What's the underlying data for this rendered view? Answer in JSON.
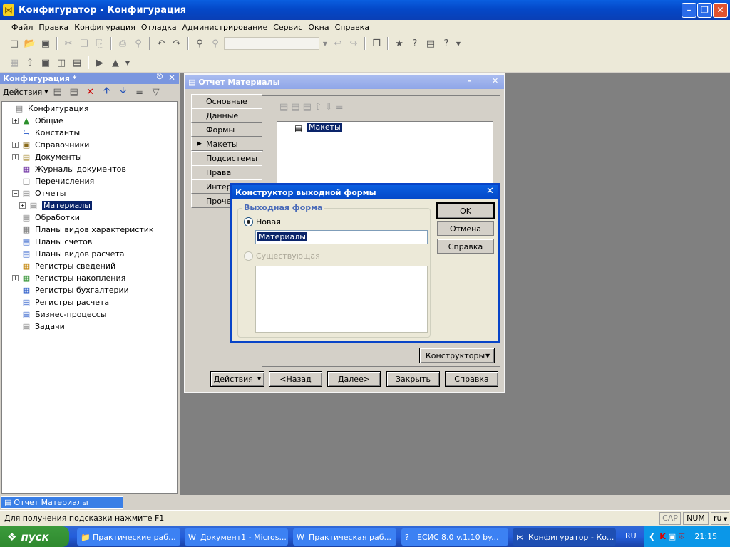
{
  "window": {
    "title": "Конфигуратор - Конфигурация"
  },
  "menu": [
    "Файл",
    "Правка",
    "Конфигурация",
    "Отладка",
    "Администрирование",
    "Сервис",
    "Окна",
    "Справка"
  ],
  "left_panel": {
    "title": "Конфигурация *",
    "actions_label": "Действия",
    "tree": [
      {
        "label": "Конфигурация",
        "level": 0,
        "expander": ""
      },
      {
        "label": "Общие",
        "level": 1,
        "expander": "+"
      },
      {
        "label": "Константы",
        "level": 1,
        "expander": ""
      },
      {
        "label": "Справочники",
        "level": 1,
        "expander": "+"
      },
      {
        "label": "Документы",
        "level": 1,
        "expander": "+"
      },
      {
        "label": "Журналы документов",
        "level": 1,
        "expander": ""
      },
      {
        "label": "Перечисления",
        "level": 1,
        "expander": ""
      },
      {
        "label": "Отчеты",
        "level": 1,
        "expander": "−"
      },
      {
        "label": "Материалы",
        "level": 2,
        "expander": "+",
        "selected": true
      },
      {
        "label": "Обработки",
        "level": 1,
        "expander": ""
      },
      {
        "label": "Планы видов характеристик",
        "level": 1,
        "expander": ""
      },
      {
        "label": "Планы счетов",
        "level": 1,
        "expander": ""
      },
      {
        "label": "Планы видов расчета",
        "level": 1,
        "expander": ""
      },
      {
        "label": "Регистры сведений",
        "level": 1,
        "expander": ""
      },
      {
        "label": "Регистры накопления",
        "level": 1,
        "expander": "+"
      },
      {
        "label": "Регистры бухгалтерии",
        "level": 1,
        "expander": ""
      },
      {
        "label": "Регистры расчета",
        "level": 1,
        "expander": ""
      },
      {
        "label": "Бизнес-процессы",
        "level": 1,
        "expander": ""
      },
      {
        "label": "Задачи",
        "level": 1,
        "expander": ""
      }
    ]
  },
  "report_window": {
    "title": "Отчет Материалы",
    "tabs": [
      "Основные",
      "Данные",
      "Формы",
      "Макеты",
      "Подсистемы",
      "Права",
      "Интерф",
      "Прочее"
    ],
    "active_tab": "Макеты",
    "tree_item": "Макеты",
    "constructors_label": "Конструкторы",
    "buttons": {
      "actions": "Действия",
      "back": "<Назад",
      "next": "Далее>",
      "close": "Закрыть",
      "help": "Справка"
    }
  },
  "dialog": {
    "title": "Конструктор выходной формы",
    "group_label": "Выходная форма",
    "option_new": "Новая",
    "new_value": "Материалы",
    "option_existing": "Существующая",
    "ok": "OK",
    "cancel": "Отмена",
    "help": "Справка"
  },
  "window_tab": "Отчет Материалы",
  "status": {
    "hint": "Для получения подсказки нажмите F1",
    "cap": "CAP",
    "num": "NUM",
    "lang": "ru"
  },
  "taskbar": {
    "start": "пуск",
    "tasks": [
      "Практические раб...",
      "Документ1 - Micros...",
      "Практическая раб...",
      "ЕСИС 8.0 v.1.10 by...",
      "Конфигуратор - Ко..."
    ],
    "lang": "RU",
    "clock": "21:15"
  }
}
